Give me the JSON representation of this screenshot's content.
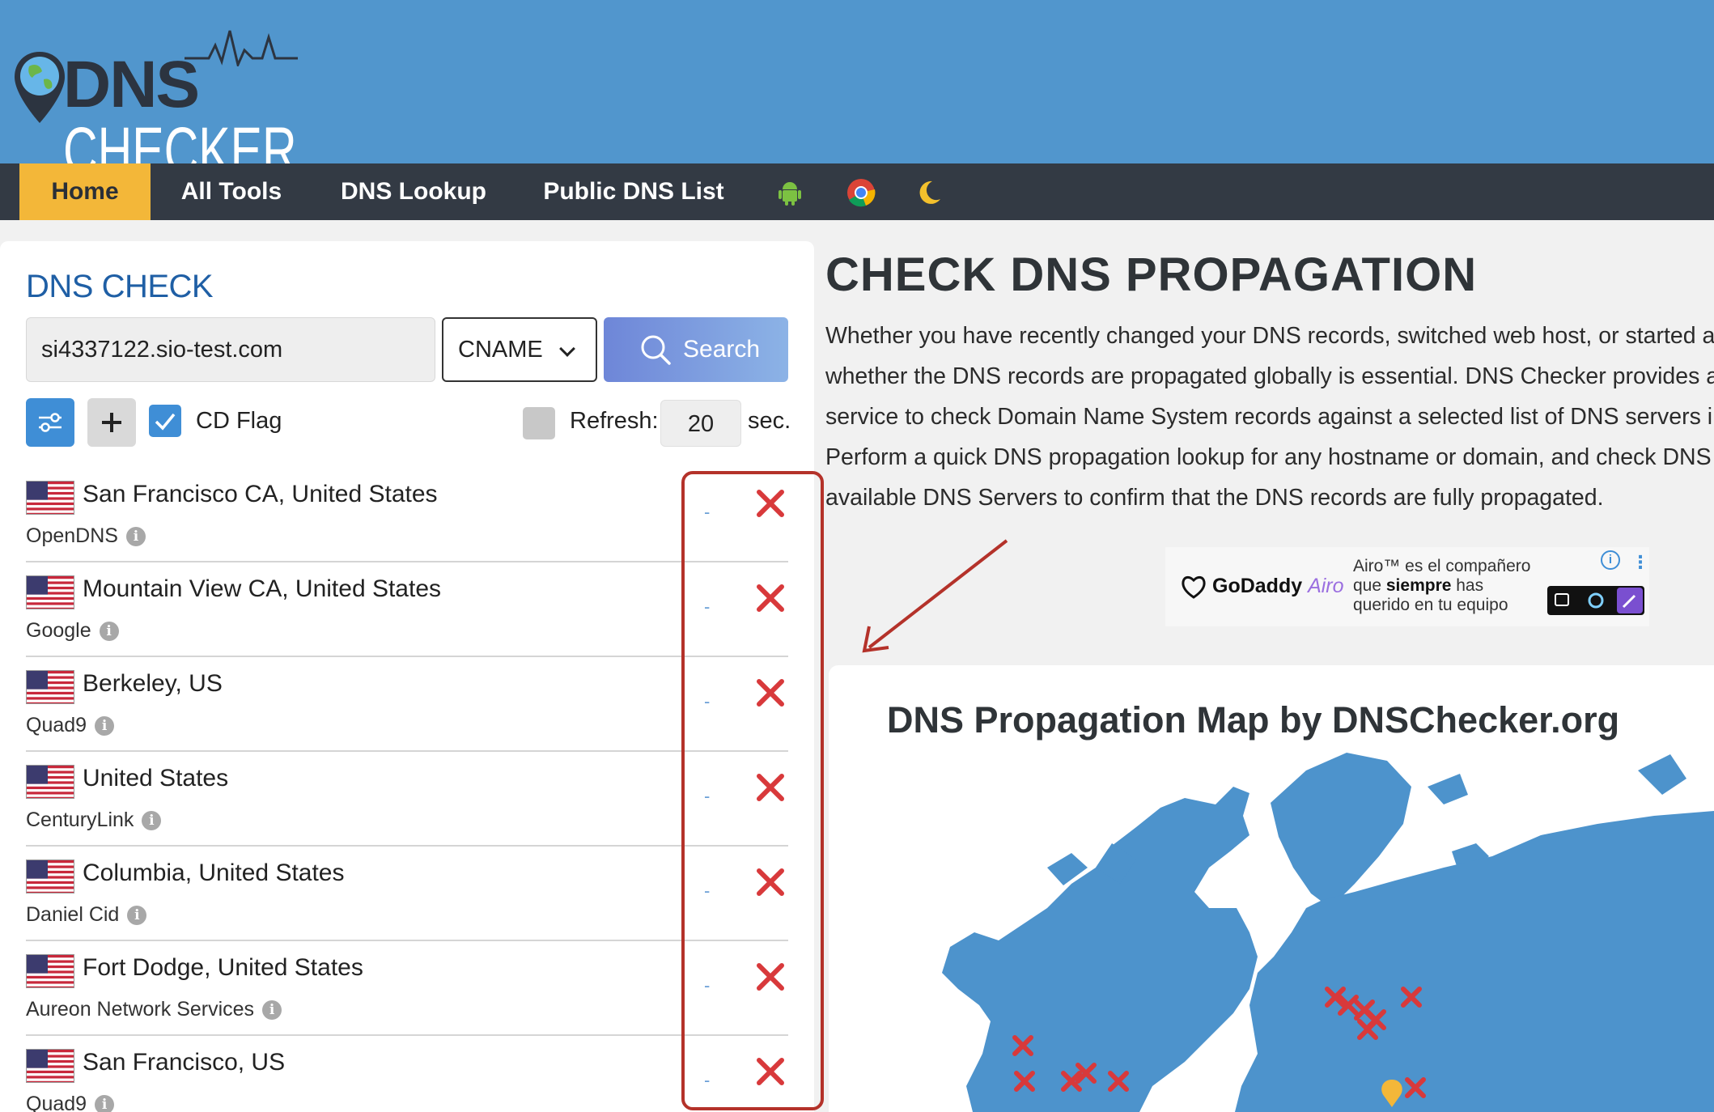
{
  "header": {
    "logo": {
      "dns": "DNS",
      "checker": "CHECKER"
    }
  },
  "nav": {
    "items": [
      "Home",
      "All Tools",
      "DNS Lookup",
      "Public DNS List"
    ],
    "icons": [
      "android-icon",
      "chrome-icon",
      "moon-icon"
    ]
  },
  "dns_check": {
    "title": "DNS CHECK",
    "domain_value": "si4337122.sio-test.com",
    "record_type": "CNAME",
    "search_label": "Search",
    "cd_flag_label": "CD Flag",
    "cd_flag_checked": true,
    "refresh_label": "Refresh:",
    "refresh_value": "20",
    "sec_label": "sec."
  },
  "results": [
    {
      "location": "San Francisco CA, United States",
      "provider": "OpenDNS",
      "value": "-"
    },
    {
      "location": "Mountain View CA, United States",
      "provider": "Google",
      "value": "-"
    },
    {
      "location": "Berkeley, US",
      "provider": "Quad9",
      "value": "-"
    },
    {
      "location": "United States",
      "provider": "CenturyLink",
      "value": "-"
    },
    {
      "location": "Columbia, United States",
      "provider": "Daniel Cid",
      "value": "-"
    },
    {
      "location": "Fort Dodge, United States",
      "provider": "Aureon Network Services",
      "value": "-"
    },
    {
      "location": "San Francisco, US",
      "provider": "Quad9",
      "value": "-"
    }
  ],
  "main": {
    "title": "CHECK DNS PROPAGATION",
    "description": [
      "Whether you have recently changed your DNS records, switched web host, or started a n",
      "whether the DNS records are propagated globally is essential. DNS Checker provides a fr",
      "service to check Domain Name System records against a selected list of DNS servers in m",
      "Perform a quick DNS propagation lookup for any hostname or domain, and check DNS da",
      "available DNS Servers to confirm that the DNS records are fully propagated."
    ]
  },
  "ad": {
    "brand": "GoDaddy",
    "brand_accent": "Airo",
    "line1": "Airo™ es el compañero",
    "line2_pre": "que ",
    "line2_bold": "siempre",
    "line2_post": " has",
    "line3": "querido en tu equipo",
    "info": "i"
  },
  "map": {
    "title": "DNS Propagation Map by DNSChecker.org"
  },
  "colors": {
    "header": "#5196cd",
    "nav": "#333a44",
    "home_tab": "#f3b739",
    "accent_blue": "#3f8ed6",
    "error_red": "#d8393b",
    "highlight": "#b4322a",
    "map_land": "#4d93cc"
  }
}
